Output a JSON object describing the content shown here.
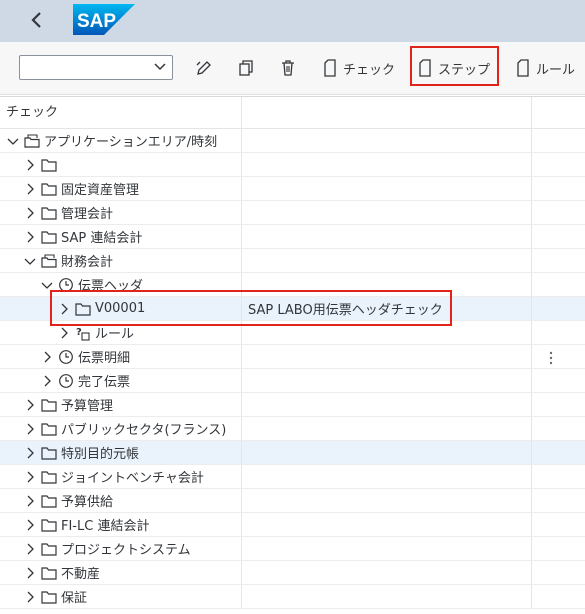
{
  "header": {
    "logo_text": "SAP",
    "back_icon": "back-icon"
  },
  "toolbar": {
    "dropdown_value": "",
    "buttons": [
      {
        "name": "edit-icon"
      },
      {
        "name": "copy-icon"
      },
      {
        "name": "delete-icon"
      },
      {
        "label": "チェック"
      },
      {
        "label": "ステップ"
      },
      {
        "label": "ルール"
      }
    ]
  },
  "table": {
    "headers": [
      "チェック",
      ""
    ],
    "rows": [
      {
        "label": "アプリケーションエリア/時刻",
        "value": ""
      },
      {
        "label": "",
        "value": ""
      },
      {
        "label": "固定資産管理",
        "value": ""
      },
      {
        "label": "管理会計",
        "value": ""
      },
      {
        "label": "SAP 連結会計",
        "value": ""
      },
      {
        "label": "財務会計",
        "value": ""
      },
      {
        "label": "伝票ヘッダ",
        "value": ""
      },
      {
        "label": "V00001",
        "value": "SAP LABO用伝票ヘッダチェック"
      },
      {
        "label": "ルール",
        "value": ""
      },
      {
        "label": "伝票明細",
        "value": ""
      },
      {
        "label": "完了伝票",
        "value": ""
      },
      {
        "label": "予算管理",
        "value": ""
      },
      {
        "label": "パブリックセクタ(フランス)",
        "value": ""
      },
      {
        "label": "特別目的元帳",
        "value": ""
      },
      {
        "label": "ジョイントベンチャ会計",
        "value": ""
      },
      {
        "label": "予算供給",
        "value": ""
      },
      {
        "label": "FI-LC 連結会計",
        "value": ""
      },
      {
        "label": "プロジェクトシステム",
        "value": ""
      },
      {
        "label": "不動産",
        "value": ""
      },
      {
        "label": "保証",
        "value": ""
      }
    ]
  },
  "colors": {
    "accent": "#0a6ed1",
    "highlight": "#e0231b",
    "shell": "#cfd9e6"
  }
}
